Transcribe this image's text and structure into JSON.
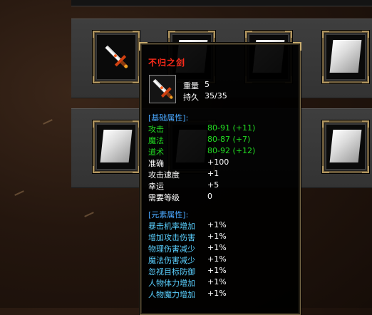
{
  "tooltip": {
    "item_name": "不归之剑",
    "stats_top": [
      {
        "label": "重量",
        "value": "5"
      },
      {
        "label": "持久",
        "value": "35/35"
      }
    ],
    "base_section_title": "[基础属性]:",
    "base_attrs": [
      {
        "label": "攻击",
        "value": "80-91 (+11)",
        "color": "#22dd22"
      },
      {
        "label": "魔法",
        "value": "80-87 (+7)",
        "color": "#22dd22"
      },
      {
        "label": "道术",
        "value": "80-92 (+12)",
        "color": "#22dd22"
      },
      {
        "label": "准确",
        "value": "+100",
        "color": "#ffffff"
      },
      {
        "label": "攻击速度",
        "value": "+1",
        "color": "#ffffff"
      },
      {
        "label": "幸运",
        "value": "+5",
        "color": "#ffffff"
      },
      {
        "label": "需要等级",
        "value": "0",
        "color": "#ffffff"
      }
    ],
    "element_section_title": "[元素属性]:",
    "element_attrs": [
      {
        "label": "暴击机率增加",
        "value": "+1%"
      },
      {
        "label": "增加攻击伤害",
        "value": "+1%"
      },
      {
        "label": "物理伤害减少",
        "value": "+1%"
      },
      {
        "label": "魔法伤害减少",
        "value": "+1%"
      },
      {
        "label": "忽视目标防御",
        "value": "+1%"
      },
      {
        "label": "人物体力增加",
        "value": "+1%"
      },
      {
        "label": "人物魔力增加",
        "value": "+1%"
      }
    ]
  },
  "inventory": {
    "row1_icons": [
      "sword-icon",
      "scroll-icon",
      "scroll-icon",
      "scroll-icon"
    ],
    "row2_icons": [
      "scroll-icon",
      "scroll-icon",
      "scroll-icon",
      "scroll-icon"
    ]
  },
  "colors": {
    "item_name": "#ff2a1a",
    "section_title": "#4aa8ff",
    "base_label_green": "#22dd22",
    "element_label": "#5ad0ff"
  }
}
